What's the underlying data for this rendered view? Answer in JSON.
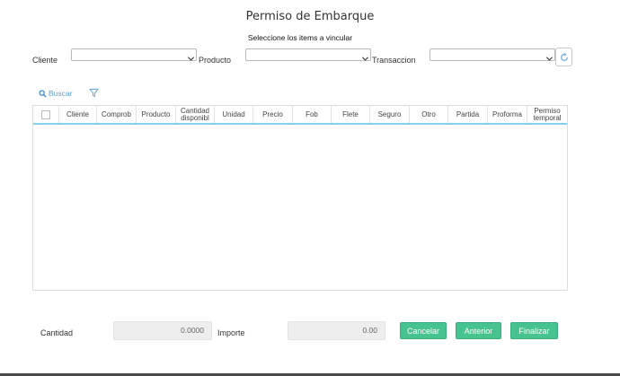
{
  "dialog": {
    "title": "Permiso de Embarque",
    "subtitle": "Seleccione los items a vincular"
  },
  "filters": {
    "cliente_label": "Cliente",
    "producto_label": "Producto",
    "transaccion_label": "Transaccion",
    "cliente_value": "",
    "producto_value": "",
    "transaccion_value": ""
  },
  "toolbar": {
    "search_label": "Buscar"
  },
  "grid": {
    "columns": [
      {
        "label": "Cliente"
      },
      {
        "label": "Comprob"
      },
      {
        "label": "Producto"
      },
      {
        "label": "Cantidad disponibl"
      },
      {
        "label": "Unidad"
      },
      {
        "label": "Precio"
      },
      {
        "label": "Fob"
      },
      {
        "label": "Flete"
      },
      {
        "label": "Seguro"
      },
      {
        "label": "Otro"
      },
      {
        "label": "Partida"
      },
      {
        "label": "Proforma"
      },
      {
        "label": "Permiso temporal"
      }
    ],
    "rows": []
  },
  "footer": {
    "cantidad_label": "Cantidad",
    "cantidad_value": "0.0000",
    "importe_label": "Importe",
    "importe_value": "0.00",
    "cancel_label": "Cancelar",
    "prev_label": "Anterior",
    "finish_label": "Finalizar"
  },
  "colors": {
    "accent_green": "#46c38f",
    "header_underline": "#7fd3ec",
    "link_blue": "#5aa0d8"
  }
}
